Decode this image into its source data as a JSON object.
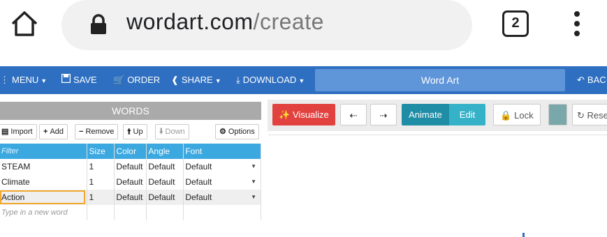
{
  "browser": {
    "url_host": "wordart.com",
    "url_path": "/create",
    "tab_count": "2",
    "icons": [
      "home-icon",
      "lock-icon",
      "kebab-menu-icon"
    ]
  },
  "toolbar": {
    "menu": "MENU",
    "save": "SAVE",
    "order": "ORDER",
    "share": "SHARE",
    "download": "DOWNLOAD",
    "title_value": "Word Art",
    "back": "BAC",
    "accent_color": "#2e6fc1"
  },
  "words": {
    "header": "WORDS",
    "buttons": {
      "import": "Import",
      "add": "Add",
      "remove": "Remove",
      "up": "Up",
      "down": "Down",
      "options": "Options"
    },
    "columns": {
      "filter": "Filter",
      "size": "Size",
      "color": "Color",
      "angle": "Angle",
      "font": "Font"
    },
    "rows": [
      {
        "word": "STEAM",
        "size": "1",
        "color": "Default",
        "angle": "Default",
        "font": "Default"
      },
      {
        "word": "Climate",
        "size": "1",
        "color": "Default",
        "angle": "Default",
        "font": "Default"
      },
      {
        "word": "Action",
        "size": "1",
        "color": "Default",
        "angle": "Default",
        "font": "Default"
      }
    ],
    "new_word_placeholder": "Type in a new word"
  },
  "editor": {
    "visualize": "Visualize",
    "animate": "Animate",
    "edit": "Edit",
    "lock": "Lock",
    "reset": "Rese",
    "visualize_color": "#e2423f",
    "animate_color": "#1f8da5",
    "edit_color": "#36b2c8",
    "swatch_color": "#7aa8aa"
  }
}
